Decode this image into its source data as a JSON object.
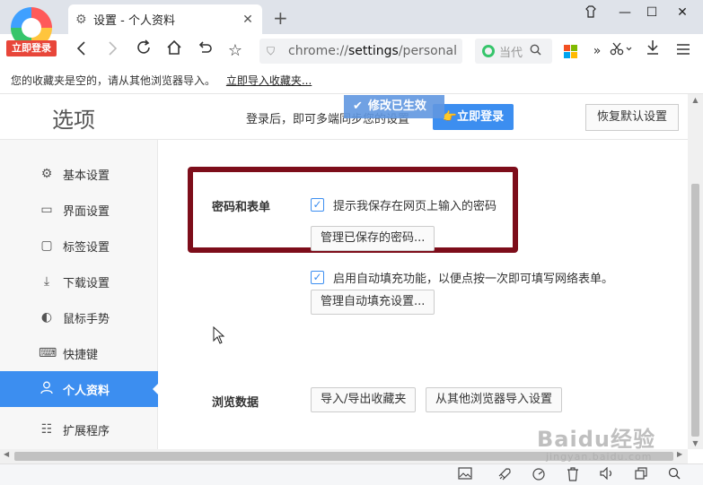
{
  "browser": {
    "login_badge": "立即登录",
    "tab": {
      "title": "设置 - 个人资料",
      "close": "✕"
    },
    "new_tab": "+",
    "address": {
      "scheme": "chrome://",
      "host": "settings",
      "path": "/personal"
    },
    "search": {
      "placeholder": "当代"
    },
    "window_controls": [
      "⌂",
      "—",
      "☐",
      "✕"
    ]
  },
  "bookmarks_bar": {
    "message": "您的收藏夹是空的，请从其他浏览器导入。",
    "import_link": "立即导入收藏夹..."
  },
  "settings": {
    "title": "选项",
    "sync_text": "登录后，即可多端同步您的设置",
    "toast": "修改已生效",
    "login_button": "立即登录",
    "restore_button": "恢复默认设置",
    "nav": [
      {
        "label": "基本设置",
        "icon": "gear-icon",
        "active": false
      },
      {
        "label": "界面设置",
        "icon": "window-icon",
        "active": false
      },
      {
        "label": "标签设置",
        "icon": "tab-icon",
        "active": false
      },
      {
        "label": "下载设置",
        "icon": "download-icon",
        "active": false
      },
      {
        "label": "鼠标手势",
        "icon": "mouse-icon",
        "active": false
      },
      {
        "label": "快捷键",
        "icon": "keyboard-icon",
        "active": false
      },
      {
        "label": "个人资料",
        "icon": "user-icon",
        "active": true
      },
      {
        "label": "扩展程序",
        "icon": "extension-icon",
        "active": false
      }
    ],
    "passwords": {
      "section_label": "密码和表单",
      "save_password_label": "提示我保存在网页上输入的密码",
      "save_password_checked": true,
      "manage_passwords_button": "管理已保存的密码...",
      "autofill_label": "启用自动填充功能，以便点按一次即可填写网络表单。",
      "autofill_checked": true,
      "manage_autofill_button": "管理自动填充设置..."
    },
    "browsing_data": {
      "section_label": "浏览数据",
      "import_export_button": "导入/导出收藏夹",
      "import_other_button": "从其他浏览器导入设置"
    }
  },
  "watermark": {
    "brand": "Baidu经验",
    "url": "jingyan.baidu.com"
  },
  "colors": {
    "accent": "#3c8ef0",
    "highlight_border": "#7d0d1a",
    "badge_red": "#e8463a"
  }
}
